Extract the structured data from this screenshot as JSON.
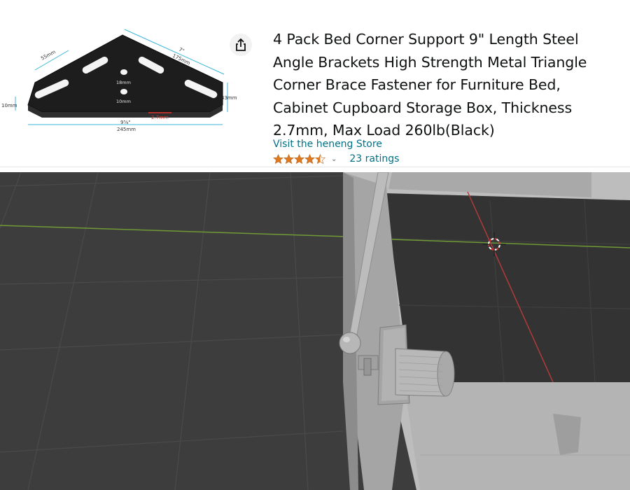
{
  "product": {
    "title": "4 Pack Bed Corner Support 9\" Length Steel Angle Brackets High Strength Metal Triangle Corner Brace Fastener for Furniture Bed, Cabinet Cupboard Storage Box, Thickness 2.7mm, Max Load 260lb(Black)",
    "store_link": "Visit the heneng Store",
    "rating": 4.5,
    "ratings_count": "23 ratings",
    "star_color": "#de7921"
  },
  "image_labels": {
    "width_7in": "7\"",
    "width_175": "175mm",
    "side_55": "55mm",
    "hole_18": "18mm",
    "hole_10": "10mm",
    "left_10": "10mm",
    "right_43": "43mm",
    "thickness": "2.7mm",
    "length_in": "9⅝\"",
    "length_mm": "245mm"
  },
  "icons": {
    "share": "share-icon",
    "chevron": "chevron-down-icon",
    "star": "star-icon"
  }
}
